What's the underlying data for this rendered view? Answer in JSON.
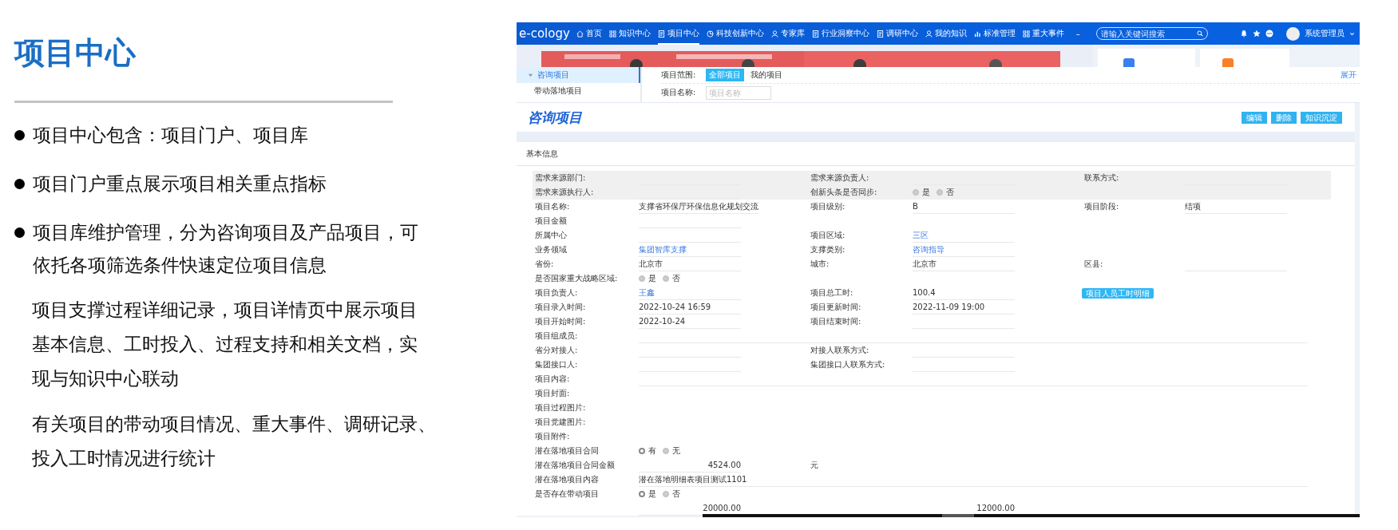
{
  "slide": {
    "title": "项目中心",
    "bullets": [
      "项目中心包含：项目门户、项目库",
      "项目门户重点展示项目相关重点指标",
      "项目库维护管理，分为咨询项目及产品项目，可依托各项筛选条件快速定位项目信息"
    ],
    "paragraphs": [
      "项目支撑过程详细记录，项目详情页中展示项目基本信息、工时投入、过程支持和相关文档，实现与知识中心联动",
      "有关项目的带动项目情况、重大事件、调研记录、投入工时情况进行统计"
    ]
  },
  "app": {
    "logo": "e-cology",
    "nav": [
      {
        "label": "首页",
        "selected": false
      },
      {
        "label": "知识中心",
        "selected": false
      },
      {
        "label": "项目中心",
        "selected": true
      },
      {
        "label": "科技创新中心",
        "selected": false
      },
      {
        "label": "专家库",
        "selected": false
      },
      {
        "label": "行业洞察中心",
        "selected": false
      },
      {
        "label": "调研中心",
        "selected": false
      },
      {
        "label": "我的知识",
        "selected": false
      },
      {
        "label": "标准管理",
        "selected": false
      },
      {
        "label": "重大事件",
        "selected": false
      }
    ],
    "nav_more": "–",
    "search": {
      "placeholder": "请输入关键词搜索"
    },
    "user": {
      "name": "系统管理员"
    },
    "sidebar": {
      "items": [
        {
          "label": "咨询项目",
          "selected": true
        },
        {
          "label": "带动落地项目",
          "selected": false
        }
      ]
    },
    "filter": {
      "scope_label": "项目范围:",
      "scopes": [
        {
          "label": "全部项目",
          "selected": true
        },
        {
          "label": "我的项目",
          "selected": false
        }
      ],
      "name_label": "项目名称:",
      "name_placeholder": "项目名称",
      "expand": "展开"
    },
    "detail": {
      "title": "咨询项目",
      "buttons": [
        "编辑",
        "删除",
        "知识沉淀"
      ],
      "section": "基本信息",
      "rows": [
        {
          "shaded": true,
          "cells": [
            {
              "label": "需求来源部门:",
              "kind": "blank"
            },
            {
              "label": "需求来源负责人:",
              "kind": "blank"
            },
            {
              "label": "联系方式:",
              "kind": "blank"
            }
          ]
        },
        {
          "shaded": true,
          "cells": [
            {
              "label": "需求来源执行人:",
              "kind": "blank"
            },
            {
              "label": "创新头条是否同步:",
              "kind": "radio",
              "options": [
                {
                  "label": "是",
                  "selected": false
                },
                {
                  "label": "否",
                  "selected": false
                }
              ]
            }
          ]
        },
        {
          "shaded": false,
          "cells": [
            {
              "label": "项目名称:",
              "kind": "text",
              "value": "支撑省环保厅环保信息化规划交流"
            },
            {
              "label": "项目级别:",
              "kind": "text",
              "value": "B"
            },
            {
              "label": "项目阶段:",
              "kind": "text",
              "value": "结项"
            }
          ]
        },
        {
          "shaded": false,
          "cells": [
            {
              "label": "项目金额",
              "kind": "blank"
            }
          ]
        },
        {
          "shaded": false,
          "cells": [
            {
              "label": "所属中心",
              "kind": "blank"
            },
            {
              "label": "项目区域:",
              "kind": "link",
              "value": "三区"
            }
          ]
        },
        {
          "shaded": false,
          "cells": [
            {
              "label": "业务领域",
              "kind": "link",
              "value": "集团智库支撑"
            },
            {
              "label": "支撑类别:",
              "kind": "link",
              "value": "咨询指导"
            }
          ]
        },
        {
          "shaded": false,
          "cells": [
            {
              "label": "省份:",
              "kind": "text",
              "value": "北京市"
            },
            {
              "label": "城市:",
              "kind": "text",
              "value": "北京市"
            },
            {
              "label": "区县:",
              "kind": "blank"
            }
          ]
        },
        {
          "shaded": false,
          "cells": [
            {
              "label": "是否国家重大战略区域:",
              "kind": "radio",
              "options": [
                {
                  "label": "是",
                  "selected": false
                },
                {
                  "label": "否",
                  "selected": false
                }
              ]
            }
          ]
        },
        {
          "shaded": false,
          "cells": [
            {
              "label": "项目负责人:",
              "kind": "link",
              "value": "王鑫"
            },
            {
              "label": "项目总工时:",
              "kind": "text",
              "value": "100.4"
            },
            {
              "kind": "button",
              "value": "项目人员工时明细"
            }
          ]
        },
        {
          "shaded": false,
          "cells": [
            {
              "label": "项目录入时间:",
              "kind": "text",
              "value": "2022-10-24 16:59"
            },
            {
              "label": "项目更新时间:",
              "kind": "text",
              "value": "2022-11-09 19:00"
            }
          ]
        },
        {
          "shaded": false,
          "cells": [
            {
              "label": "项目开始时间:",
              "kind": "text",
              "value": "2022-10-24"
            },
            {
              "label": "项目结束时间:",
              "kind": "blank"
            }
          ]
        },
        {
          "shaded": false,
          "cells": [
            {
              "label": "项目组成员:",
              "kind": "wide"
            }
          ]
        },
        {
          "shaded": false,
          "cells": [
            {
              "label": "省分对接人:",
              "kind": "blank"
            },
            {
              "label": "对接人联系方式:",
              "kind": "blank"
            }
          ]
        },
        {
          "shaded": false,
          "cells": [
            {
              "label": "集团接口人:",
              "kind": "blank"
            },
            {
              "label": "集团接口人联系方式:",
              "kind": "blank"
            }
          ]
        },
        {
          "shaded": false,
          "cells": [
            {
              "label": "项目内容:",
              "kind": "wide"
            }
          ]
        },
        {
          "shaded": false,
          "cells": [
            {
              "label": "项目封面:",
              "kind": "label"
            }
          ]
        },
        {
          "shaded": false,
          "cells": [
            {
              "label": "项目过程图片:",
              "kind": "label"
            }
          ]
        },
        {
          "shaded": false,
          "cells": [
            {
              "label": "项目党建图片:",
              "kind": "label"
            }
          ]
        },
        {
          "shaded": false,
          "cells": [
            {
              "label": "项目附件:",
              "kind": "label"
            }
          ]
        },
        {
          "shaded": false,
          "cells": [
            {
              "label": "潜在落地项目合同",
              "kind": "radio",
              "options": [
                {
                  "label": "有",
                  "selected": true
                },
                {
                  "label": "无",
                  "selected": false
                }
              ]
            }
          ]
        },
        {
          "shaded": false,
          "cells": [
            {
              "label": "潜在落地项目合同金额",
              "kind": "amount",
              "value": "4524.00"
            },
            {
              "label": "元",
              "kind": "label"
            }
          ]
        },
        {
          "shaded": false,
          "cells": [
            {
              "label": "潜在落地项目内容",
              "kind": "wide",
              "value": "潜在落地明细表项目测试1101"
            }
          ]
        },
        {
          "shaded": false,
          "cells": [
            {
              "label": "是否存在带动项目",
              "kind": "radio",
              "options": [
                {
                  "label": "是",
                  "selected": true
                },
                {
                  "label": "否",
                  "selected": false
                }
              ]
            }
          ]
        },
        {
          "shaded": false,
          "cells": [
            {
              "kind": "amount",
              "value": "20000.00"
            },
            {
              "kind": "amount",
              "value": "12000.00"
            }
          ]
        }
      ]
    }
  }
}
